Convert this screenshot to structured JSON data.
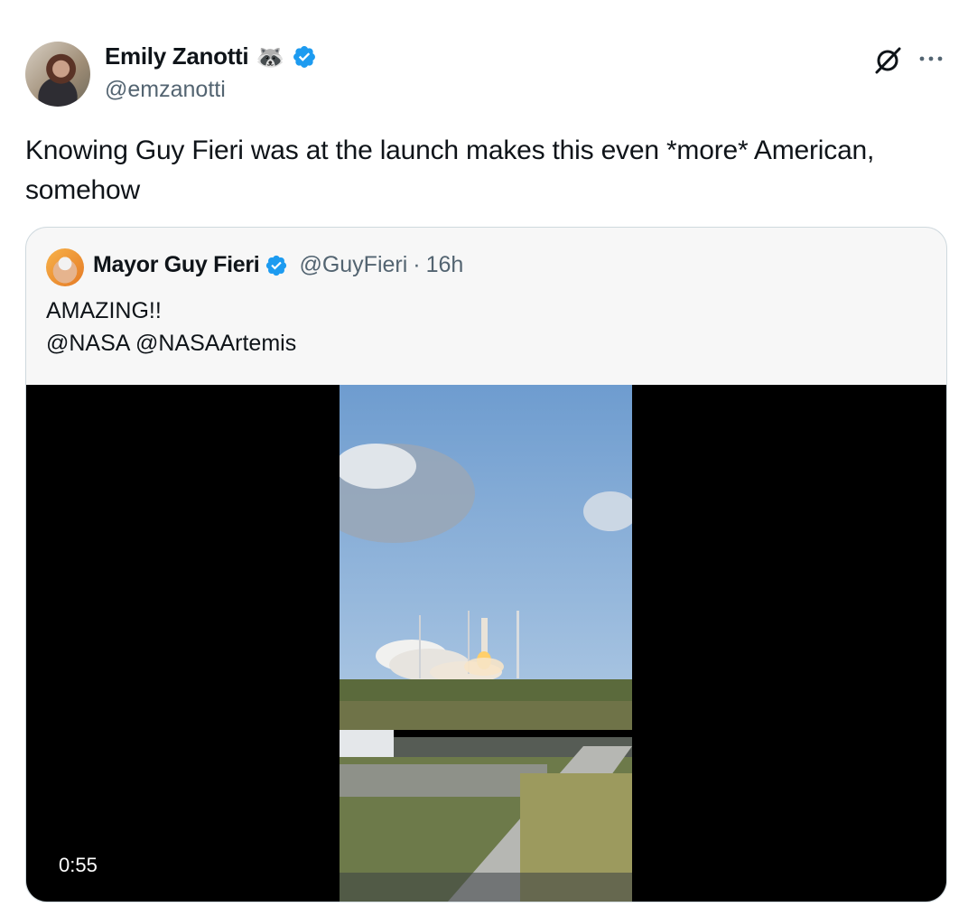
{
  "tweet": {
    "author_name": "Emily Zanotti",
    "author_emoji": "🦝",
    "handle": "@emzanotti",
    "text": "Knowing Guy Fieri was at the launch makes this even *more* American, somehow"
  },
  "icons": {
    "verified": "verified-badge-icon",
    "grok": "grok-icon",
    "more": "more-options-icon"
  },
  "colors": {
    "verified": "#1d9bf0",
    "secondary_text": "#536471",
    "border": "#cfd9de"
  },
  "quote": {
    "author_name": "Mayor Guy Fieri",
    "handle": "@GuyFieri",
    "separator": "·",
    "time": "16h",
    "text_line1": "AMAZING!!",
    "text_line2": "@NASA @NASAArtemis"
  },
  "video": {
    "duration": "0:55"
  }
}
